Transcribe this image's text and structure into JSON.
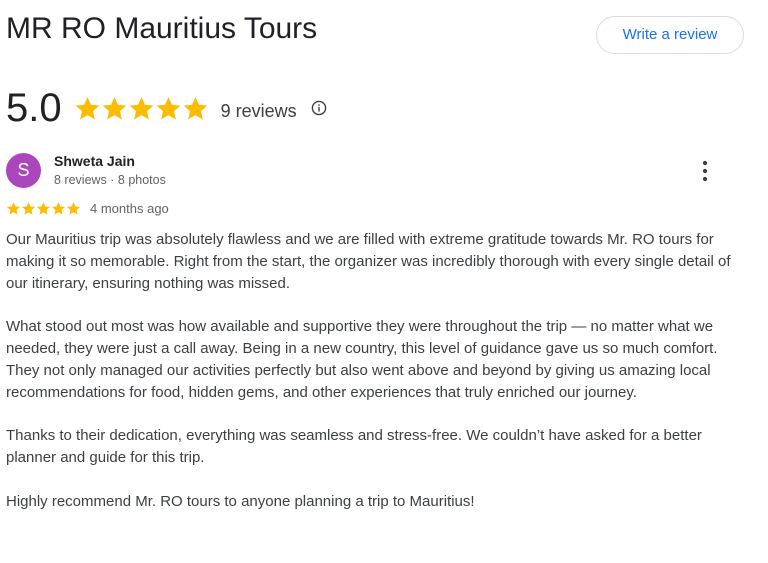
{
  "business": {
    "name": "MR RO Mauritius Tours",
    "write_review_label": "Write a review"
  },
  "rating": {
    "value": "5.0",
    "stars": 5,
    "review_count_label": "9 reviews",
    "star_color": "#fbbc04"
  },
  "review": {
    "avatar_letter": "S",
    "avatar_color": "#ab47bc",
    "reviewer_name": "Shweta Jain",
    "reviewer_meta": "8 reviews · 8 photos",
    "stars": 5,
    "date": "4 months ago",
    "paragraphs": [
      "Our Mauritius trip was absolutely flawless and we are filled with extreme gratitude towards Mr. RO tours for making it so memorable. Right from the start, the organizer was incredibly thorough with every single detail of our itinerary, ensuring nothing was missed.",
      "What stood out most was how available and supportive they were throughout the trip — no matter what we needed, they were just a call away. Being in a new country, this level of guidance gave us so much comfort. They not only managed our activities perfectly but also went above and beyond by giving us amazing local recommendations for food, hidden gems, and other experiences that truly enriched our journey.",
      "Thanks to their dedication, everything was seamless and stress-free. We couldn’t have asked for a better planner and guide for this trip.",
      "Highly recommend Mr. RO tours to anyone planning a trip to Mauritius!"
    ]
  },
  "icons": {
    "star": "star-icon",
    "info": "info-icon",
    "more": "more-vert-icon"
  }
}
